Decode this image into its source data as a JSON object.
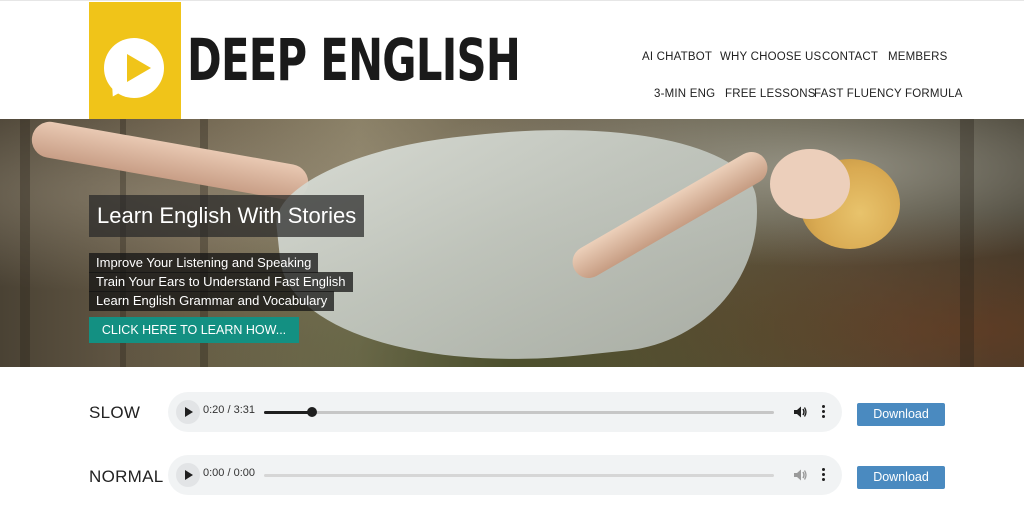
{
  "brand": {
    "name": "DEEP ENGLISH",
    "logo_color": "#f0c419"
  },
  "nav": {
    "row1": [
      "AI CHATBOT",
      "WHY CHOOSE US",
      "CONTACT",
      "MEMBERS"
    ],
    "row2": [
      "3-MIN ENG",
      "FREE LESSONS",
      "FAST FLUENCY FORMULA"
    ]
  },
  "hero": {
    "title": "Learn English With Stories",
    "bullets": [
      "Improve Your Listening and Speaking",
      "Train Your Ears to Understand Fast English",
      "Learn English Grammar and Vocabulary"
    ],
    "cta_label": "CLICK HERE TO LEARN HOW...",
    "cta_color": "#139082"
  },
  "audio": [
    {
      "label": "SLOW",
      "time": "0:20 / 3:31",
      "progress": 0.095,
      "download_label": "Download"
    },
    {
      "label": "NORMAL",
      "time": "0:00 / 0:00",
      "progress": 0,
      "download_label": "Download"
    }
  ],
  "colors": {
    "download_button": "#4a8ac0",
    "player_bg": "#f1f3f4"
  }
}
